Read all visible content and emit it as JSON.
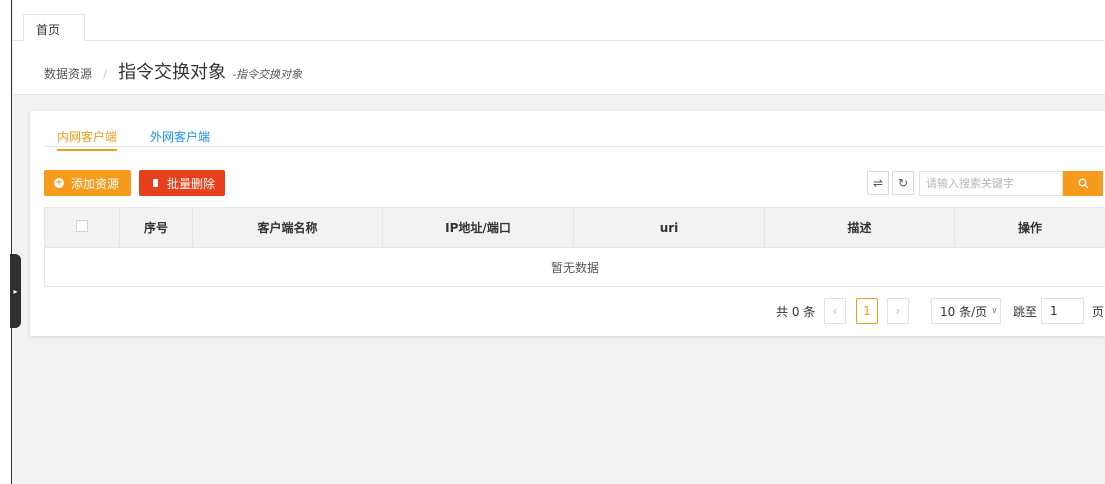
{
  "tabs_bar": {
    "home_tab": "首页"
  },
  "breadcrumb": {
    "root": "数据资源",
    "separator": "/",
    "title": "指令交换对象",
    "subtitle": "-指令交换对象"
  },
  "subtabs": [
    {
      "label": "内网客户端",
      "active": true
    },
    {
      "label": "外网客户端",
      "active": false
    }
  ],
  "toolbar": {
    "add_label": "添加资源",
    "batch_delete_label": "批量删除",
    "search_placeholder": "请输入搜索关键字"
  },
  "table": {
    "columns": [
      "序号",
      "客户端名称",
      "IP地址/端口",
      "uri",
      "描述",
      "操作"
    ],
    "empty_text": "暂无数据"
  },
  "pagination": {
    "total": "共 0 条",
    "current_page": "1",
    "page_size": "10 条/页",
    "jump_label": "跳至",
    "jump_value": "1",
    "page_unit": "页"
  },
  "colors": {
    "accent": "#f79b1d",
    "danger": "#e8401c",
    "link": "#1890ff"
  },
  "icons": {
    "add": "plus-circle-icon",
    "delete": "trash-icon",
    "columns": "filter-columns-icon",
    "refresh": "refresh-icon",
    "search": "search-icon"
  }
}
